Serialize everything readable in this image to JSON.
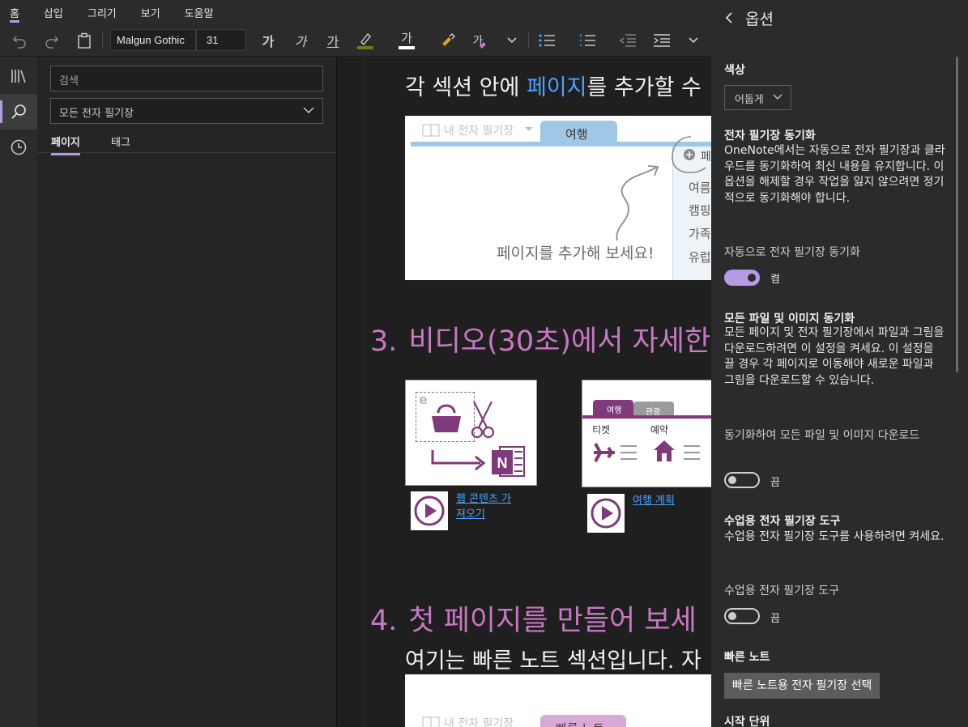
{
  "menu": {
    "tabs": [
      {
        "label": "홈",
        "active": true
      },
      {
        "label": "삽입"
      },
      {
        "label": "그리기"
      },
      {
        "label": "보기"
      },
      {
        "label": "도움말"
      }
    ]
  },
  "ribbon": {
    "font_name": "Malgun Gothic",
    "font_size": "31",
    "bold_label": "가",
    "italic_label": "가",
    "underline_label": "가",
    "font_color_label": "가",
    "styles_label": "가"
  },
  "search_pane": {
    "search_placeholder": "검색",
    "scope_value": "모든 전자 필기장",
    "tabs": [
      {
        "label": "페이지",
        "active": true
      },
      {
        "label": "태그"
      }
    ]
  },
  "page": {
    "line1_prefix": "각 섹션 안에 ",
    "line1_link": "페이지",
    "line1_suffix": "를 추가할 수",
    "illustration1": {
      "notebook_label": "내 전자 필기장",
      "section_tab": "여행",
      "add_page_hint": "페이지를 추가해 보세요!",
      "add_page_label": "페",
      "pages": [
        "여름",
        "캠핑",
        "가족",
        "유럽"
      ]
    },
    "heading3_number": "3.",
    "heading3_text": "비디오(30초)에서 자세한",
    "video1_link": "웹 콘텐츠 가져오기",
    "video2_link": "여행 계획",
    "video2_tabs": [
      "여행",
      "관광"
    ],
    "video2_cols": [
      "티켓",
      "예약"
    ],
    "heading4_number": "4.",
    "heading4_text": "첫 페이지를 만들어 보세",
    "line2": "여기는 빠른 노트 섹션입니다. 자",
    "illustration2": {
      "notebook_label": "내 전자 필기장",
      "section_tab": "빠른 노트"
    }
  },
  "options": {
    "title": "옵션",
    "color_heading": "색상",
    "color_value": "어둡게",
    "sync_heading": "전자 필기장 동기화",
    "sync_desc": "OneNote에서는 자동으로 전자 필기장과 클라우드를 동기화하여 최신 내용을 유지합니다. 이 옵션을 해제할 경우 작업을 잃지 않으려면 정기적으로 동기화해야 합니다.",
    "sync_toggle_label": "자동으로 전자 필기장 동기화",
    "sync_toggle_state": "켬",
    "files_heading": "모든 파일 및 이미지 동기화",
    "files_desc": "모든 페이지 및 전자 필기장에서 파일과 그림을 다운로드하려면 이 설정을 켜세요. 이 설정을 끌 경우 각 페이지로 이동해야 새로운 파일과 그림을 다운로드할 수 있습니다.",
    "files_toggle_label": "동기화하여 모든 파일 및 이미지 다운로드",
    "files_toggle_state": "끔",
    "class_heading": "수업용 전자 필기장 도구",
    "class_desc": "수업용 전자 필기장 도구를 사용하려면 켜세요.",
    "class_toggle_label": "수업용 전자 필기장 도구",
    "class_toggle_state": "끔",
    "quick_heading": "빠른 노트",
    "quick_button": "빠른 노트용 전자 필기장 선택",
    "cutoff_heading": "시작 단위"
  },
  "colors": {
    "accent": "#b69ae6",
    "heading": "#c678c2",
    "link": "#4aa3ff",
    "onenote_purple": "#80397b"
  }
}
